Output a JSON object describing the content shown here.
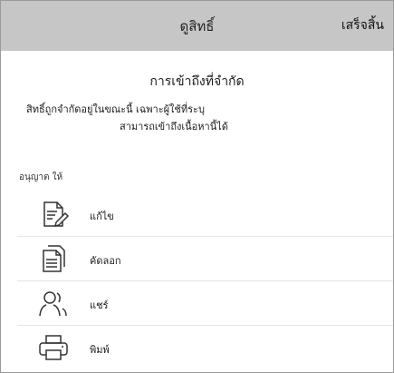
{
  "header": {
    "title": "ดูสิทธิ์",
    "done_label": "เสร็จสิ้น"
  },
  "restriction": {
    "title": "การเข้าถึงที่จำกัด",
    "description_line1": "สิทธิ์ถูกจำกัดอยู่ในขณะนี้ เฉพาะผู้ใช้ที่ระบุ",
    "description_line2": "สามารถเข้าถึงเนื้อหานี้ได้"
  },
  "permissions": {
    "heading": "อนุญาต ให้",
    "items": [
      {
        "label": "แก้ไข",
        "icon": "edit-document-icon"
      },
      {
        "label": "คัดลอก",
        "icon": "copy-document-icon"
      },
      {
        "label": "แชร์",
        "icon": "share-icon"
      },
      {
        "label": "พิมพ์",
        "icon": "printer-icon"
      }
    ]
  }
}
